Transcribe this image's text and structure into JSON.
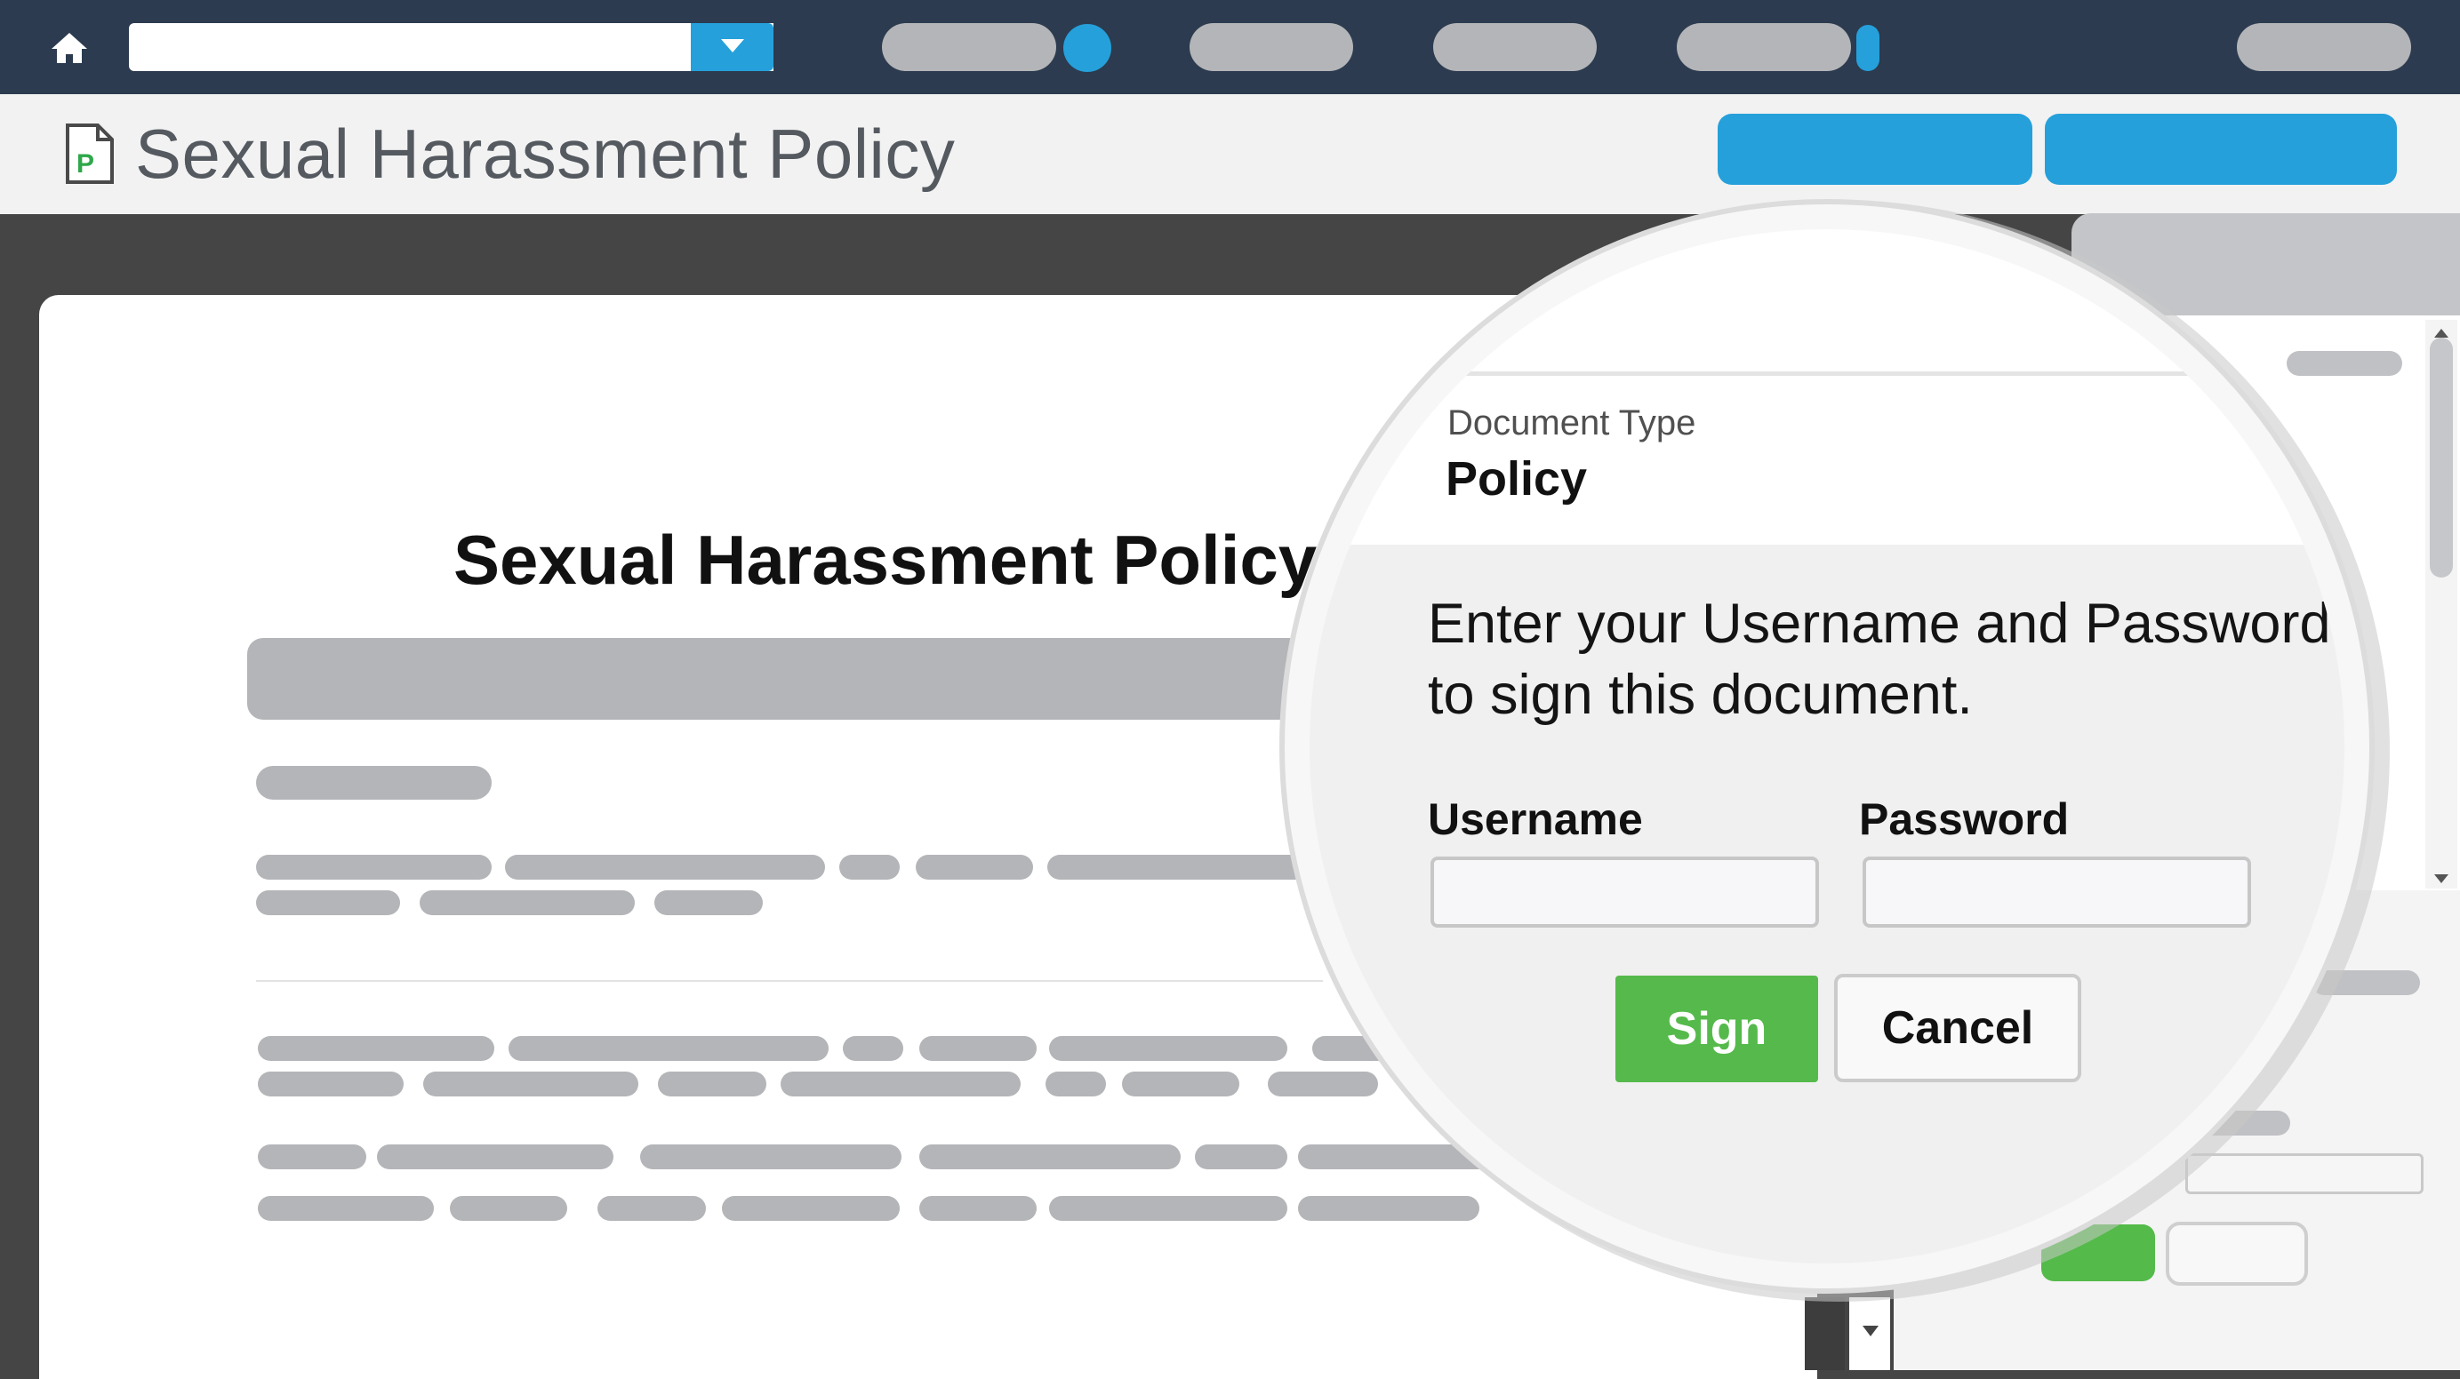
{
  "header": {
    "document_title": "Sexual Harassment Policy",
    "colors": {
      "topbar": "#2c3b4f",
      "accent": "#25a0da",
      "sign": "#55ba4b"
    },
    "icons": {
      "home": "home-icon",
      "dropdown": "chevron-down-icon",
      "document": "policy-document-icon"
    },
    "doc_icon_letter": "P"
  },
  "document": {
    "heading": "Sexual Harassment Policy"
  },
  "signature_dialog": {
    "doc_type_label": "Document Type",
    "doc_type_value": "Policy",
    "instructions_line1": "Enter your Username and Password",
    "instructions_line2": "to sign this document.",
    "username_label": "Username",
    "password_label": "Password",
    "sign_label": "Sign",
    "cancel_label": "Cancel"
  }
}
